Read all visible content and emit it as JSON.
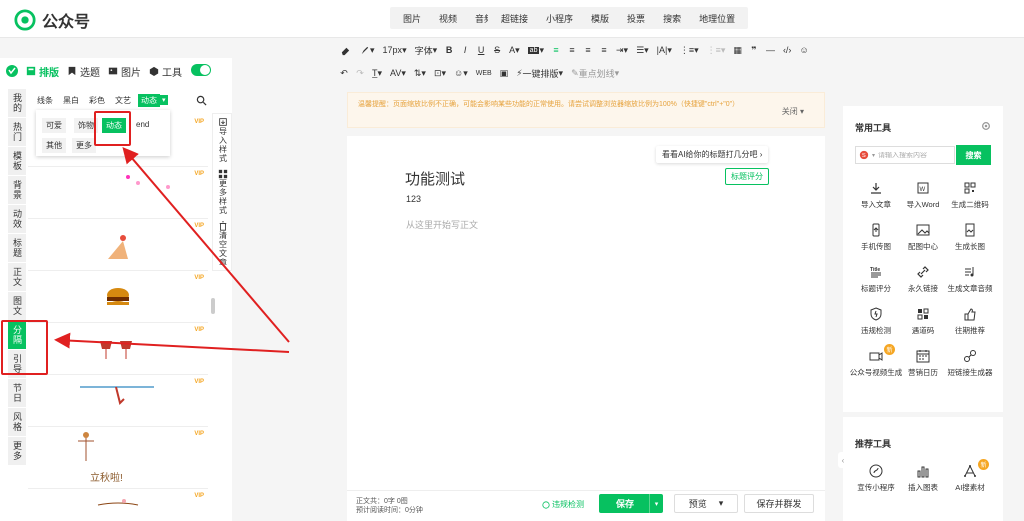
{
  "app": {
    "name": "公众号",
    "accent": "#07c160",
    "annotation_color": "#e02020"
  },
  "top_menu": {
    "group1": [
      "图片",
      "视频",
      "音频"
    ],
    "group2": [
      "超链接",
      "小程序",
      "模版",
      "投票",
      "搜索",
      "地理位置"
    ]
  },
  "toolbar": {
    "font_size": "17px",
    "font_family": "字体",
    "format_painter": "一键排版",
    "highlight": "重点划线"
  },
  "left_panel": {
    "tabs": [
      {
        "label": "排版",
        "icon": "layout-icon",
        "active": true
      },
      {
        "label": "选题",
        "icon": "bookmark-icon"
      },
      {
        "label": "图片",
        "icon": "image-icon"
      },
      {
        "label": "工具",
        "icon": "cube-icon"
      }
    ],
    "categories": [
      "我的",
      "热门",
      "模板",
      "背景",
      "动效",
      "标题",
      "正文",
      "图文",
      "分隔",
      "引导",
      "节日",
      "风格",
      "更多"
    ],
    "active_category": "分隔",
    "subtabs": [
      "线条",
      "黑白",
      "彩色",
      "文艺",
      "动态"
    ],
    "active_subtab": "动态",
    "dropdown_chips": [
      "可爱",
      "饰物",
      "动态",
      "end",
      "其他",
      "更多"
    ],
    "active_chip": "动态",
    "vip_label": "VIP",
    "sample_text": "立秋啦!",
    "side_buttons": [
      "导入样式",
      "更多样式",
      "清空文章"
    ]
  },
  "notice": {
    "text": "温馨提醒：页面缩放比例不正确，可能会影响某些功能的正常使用。请尝试调整浏览器缩放比例为100%（快捷键\"ctrl\"+\"0\"）",
    "close": "关闭"
  },
  "editor": {
    "ai_button": "看看AI给你的标题打几分吧",
    "title_score_button": "标题评分",
    "title": "功能测试",
    "author": "123",
    "placeholder": "从这里开始写正文"
  },
  "bottom_bar": {
    "word_count": "正文共：0字 0图",
    "read_time": "预计阅读时间：0分钟",
    "violation_check": "违规检测",
    "save": "保存",
    "preview": "预览",
    "save_send": "保存并群发"
  },
  "right_panel": {
    "common_title": "常用工具",
    "search_placeholder": "请输入搜索内容",
    "search_button": "搜索",
    "tools": [
      {
        "label": "导入文章",
        "icon": "download-icon"
      },
      {
        "label": "导入Word",
        "icon": "word-icon"
      },
      {
        "label": "生成二维码",
        "icon": "qrcode-icon"
      },
      {
        "label": "手机传图",
        "icon": "phone-icon"
      },
      {
        "label": "配图中心",
        "icon": "picture-icon"
      },
      {
        "label": "生成长图",
        "icon": "long-image-icon"
      },
      {
        "label": "标题评分",
        "icon": "title-icon"
      },
      {
        "label": "永久链接",
        "icon": "link-icon"
      },
      {
        "label": "生成文章音频",
        "icon": "music-icon"
      },
      {
        "label": "违规检测",
        "icon": "shield-icon"
      },
      {
        "label": "遇道码",
        "icon": "barcode-icon"
      },
      {
        "label": "往期推荐",
        "icon": "thumb-icon"
      },
      {
        "label": "公众号视频生成",
        "icon": "video-icon",
        "badge": "新"
      },
      {
        "label": "营销日历",
        "icon": "calendar-icon"
      },
      {
        "label": "短链接生成器",
        "icon": "chain-icon"
      }
    ],
    "recommend_title": "推荐工具",
    "recommend": [
      {
        "label": "宣传小程序",
        "icon": "miniapp-icon"
      },
      {
        "label": "插入图表",
        "icon": "chart-icon"
      },
      {
        "label": "AI搜素材",
        "icon": "ai-icon",
        "badge": "新"
      }
    ]
  }
}
